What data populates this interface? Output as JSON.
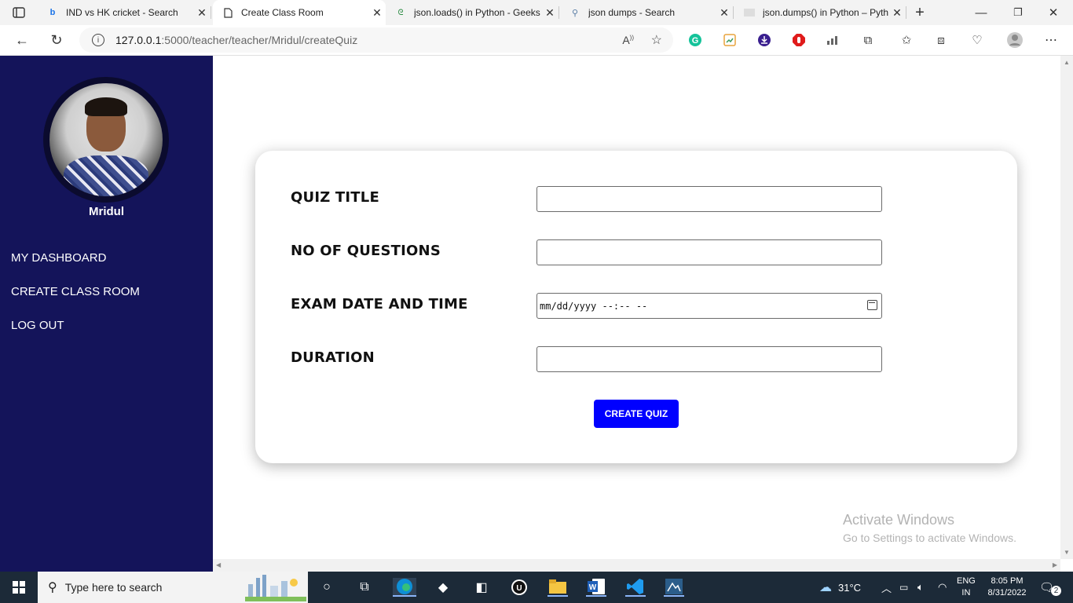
{
  "browser": {
    "tabs": [
      {
        "title": "IND vs HK cricket - Search",
        "icon": "bing-icon"
      },
      {
        "title": "Create Class Room",
        "icon": "page-icon"
      },
      {
        "title": "json.loads() in Python - Geeks",
        "icon": "geeks-icon"
      },
      {
        "title": "json dumps - Search",
        "icon": "search-icon"
      },
      {
        "title": "json.dumps() in Python – Pyth",
        "icon": "page-icon"
      }
    ],
    "url_host": "127.0.0.1",
    "url_path": ":5000/teacher/teacher/Mridul/createQuiz"
  },
  "sidebar": {
    "user_name": "Mridul",
    "items": [
      {
        "label": "MY DASHBOARD"
      },
      {
        "label": "CREATE CLASS ROOM"
      },
      {
        "label": "LOG OUT"
      }
    ]
  },
  "form": {
    "fields": [
      {
        "label": "QUIZ TITLE",
        "value": ""
      },
      {
        "label": "NO OF QUESTIONS",
        "value": ""
      },
      {
        "label": "EXAM DATE AND TIME",
        "value": "mm/dd/yyyy --:-- --"
      },
      {
        "label": "DURATION",
        "value": ""
      }
    ],
    "submit_label": "CREATE QUIZ"
  },
  "watermark": {
    "title": "Activate Windows",
    "subtitle": "Go to Settings to activate Windows."
  },
  "taskbar": {
    "search_placeholder": "Type here to search",
    "temperature": "31°C",
    "language": "ENG",
    "region": "IN",
    "time": "8:05 PM",
    "date": "8/31/2022",
    "notification_count": "2"
  },
  "colors": {
    "sidebar_bg": "#14145a",
    "button_bg": "#0000ff"
  }
}
